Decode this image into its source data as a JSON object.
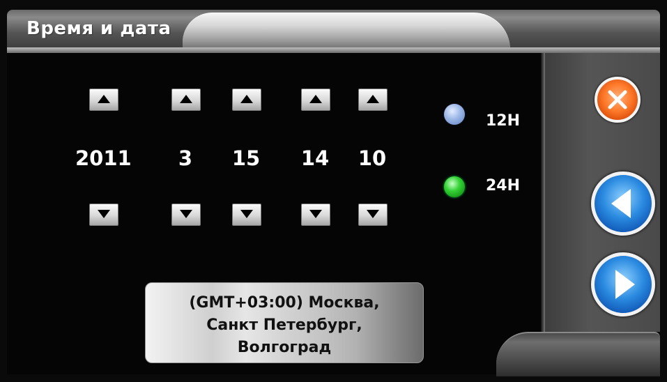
{
  "header": {
    "title": "Время и дата"
  },
  "datetime": {
    "year": "2011",
    "month": "3",
    "day": "15",
    "hour": "14",
    "minute": "10"
  },
  "clock_format": {
    "options": [
      {
        "label": "12H",
        "selected": false,
        "color": "#9ab6e6"
      },
      {
        "label": "24H",
        "selected": true,
        "color": "#34d234"
      }
    ]
  },
  "timezone": {
    "line1": "(GMT+03:00) Москва,",
    "line2": "Санкт Петербург,",
    "line3": "Волгоград"
  },
  "side_buttons": {
    "close_icon": "close-icon",
    "back_icon": "arrow-left-icon",
    "forward_icon": "arrow-right-icon"
  },
  "colors": {
    "accent_orange": "#ff7a2a",
    "accent_blue": "#2b8be0"
  }
}
